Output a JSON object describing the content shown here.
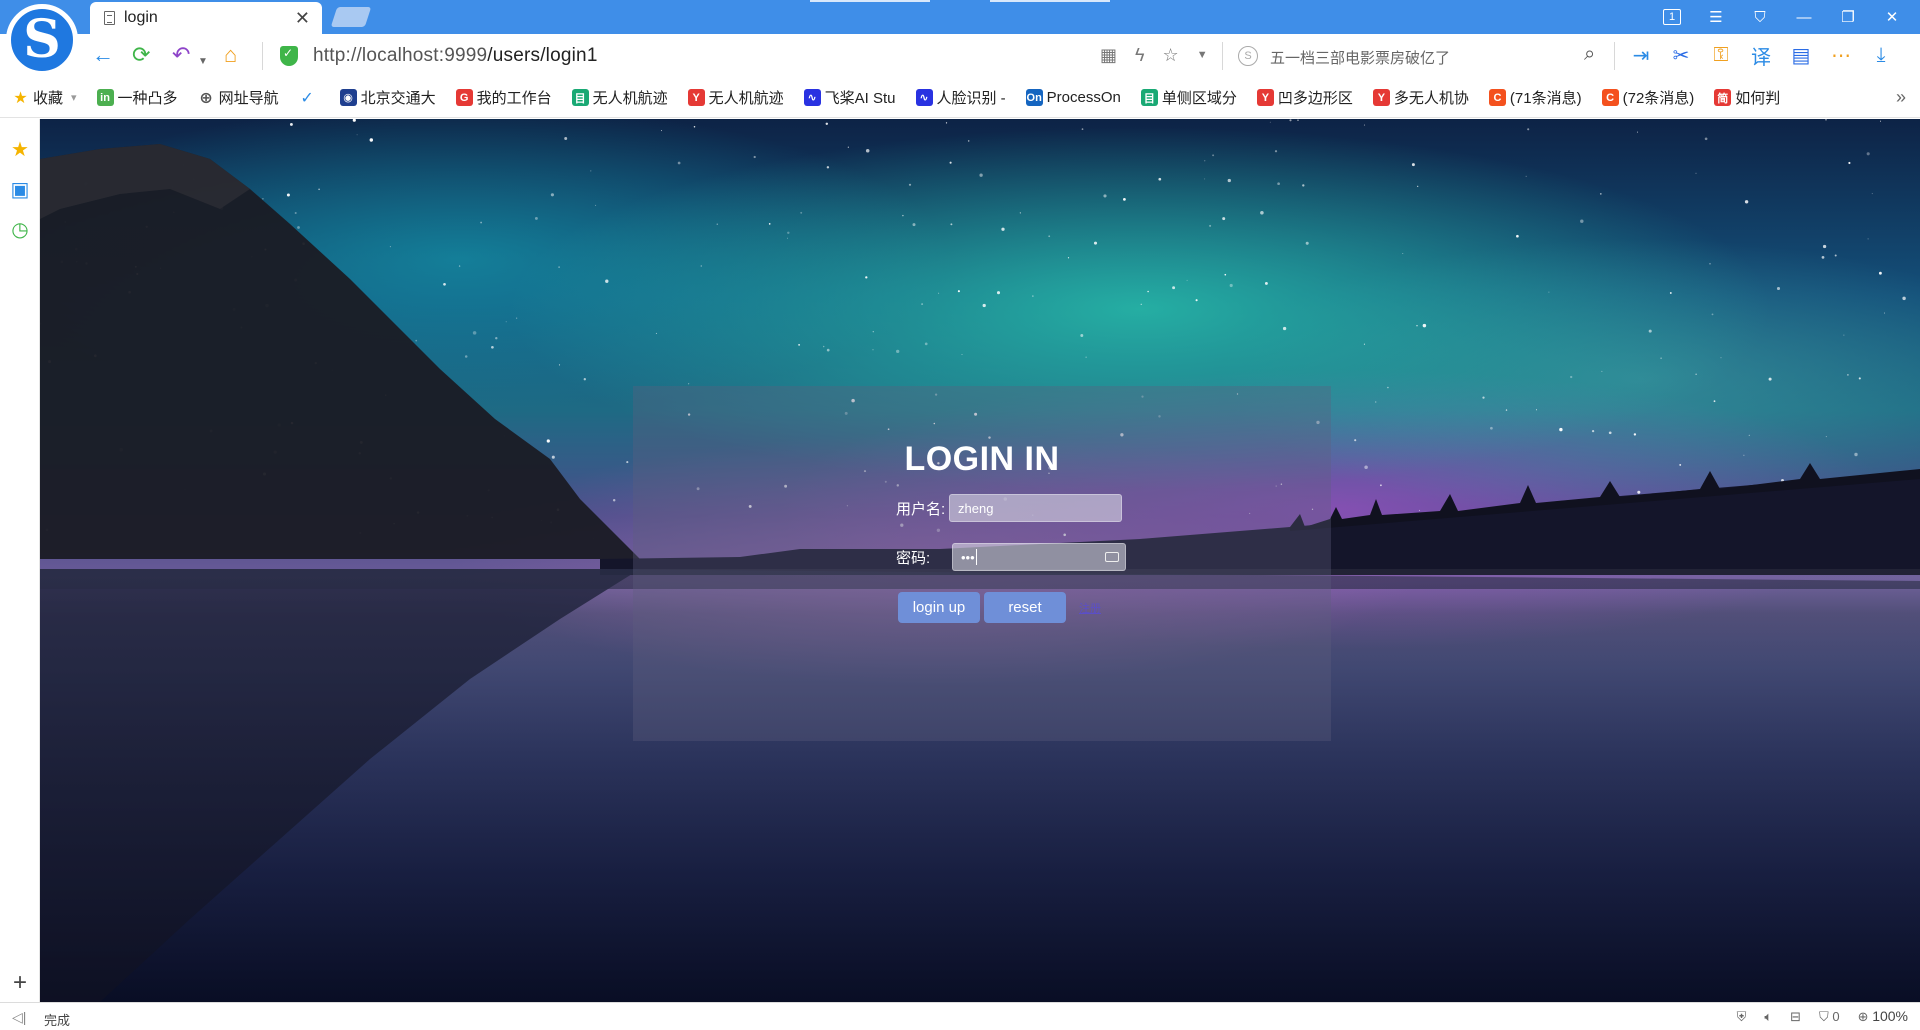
{
  "browser": {
    "tab_title": "login",
    "url_host": "http://localhost:9999",
    "url_path": "/users/login1",
    "search_placeholder": "五一档三部电影票房破亿了",
    "window_counter": "1",
    "bookmarks": [
      {
        "label": "收藏",
        "icon": "star-icon",
        "color": "#f5b400"
      },
      {
        "label": "一种凸多",
        "icon": "in-icon",
        "color": "#4caf50"
      },
      {
        "label": "网址导航",
        "icon": "globe-icon",
        "color": "#555555"
      },
      {
        "label": "",
        "icon": "check-icon",
        "color": "#2b8be5"
      },
      {
        "label": "北京交通大",
        "icon": "university-icon",
        "color": "#1f3f8f"
      },
      {
        "label": "我的工作台",
        "icon": "g-icon",
        "color": "#e53935"
      },
      {
        "label": "无人机航迹",
        "icon": "doc-icon",
        "color": "#19a974"
      },
      {
        "label": "无人机航迹",
        "icon": "y-icon",
        "color": "#e53935"
      },
      {
        "label": "飞桨AI Stu",
        "icon": "paddle-icon",
        "color": "#2932e1"
      },
      {
        "label": "人脸识别 -",
        "icon": "paddle-icon",
        "color": "#2932e1"
      },
      {
        "label": "ProcessOn",
        "icon": "on-icon",
        "color": "#1565c0"
      },
      {
        "label": "单侧区域分",
        "icon": "doc-icon",
        "color": "#19a974"
      },
      {
        "label": "凹多边形区",
        "icon": "y-icon",
        "color": "#e53935"
      },
      {
        "label": "多无人机协",
        "icon": "y-icon",
        "color": "#e53935"
      },
      {
        "label": "(71条消息)",
        "icon": "c-icon",
        "color": "#f4511e"
      },
      {
        "label": "(72条消息)",
        "icon": "c-icon",
        "color": "#f4511e"
      },
      {
        "label": "如何判",
        "icon": "jian-icon",
        "color": "#e53935"
      }
    ]
  },
  "login": {
    "title": "LOGIN IN",
    "username_label": "用户名:",
    "username_value": "zheng",
    "password_label": "密码:",
    "password_value": "•••",
    "login_button": "login up",
    "reset_button": "reset",
    "register_link": "注册"
  },
  "status": {
    "text": "完成",
    "blocked_count": "0",
    "zoom": "100%"
  },
  "colors": {
    "titlebar": "#3f8ee8",
    "button": "#6f8fd8",
    "accent_blue": "#2b8be5"
  }
}
